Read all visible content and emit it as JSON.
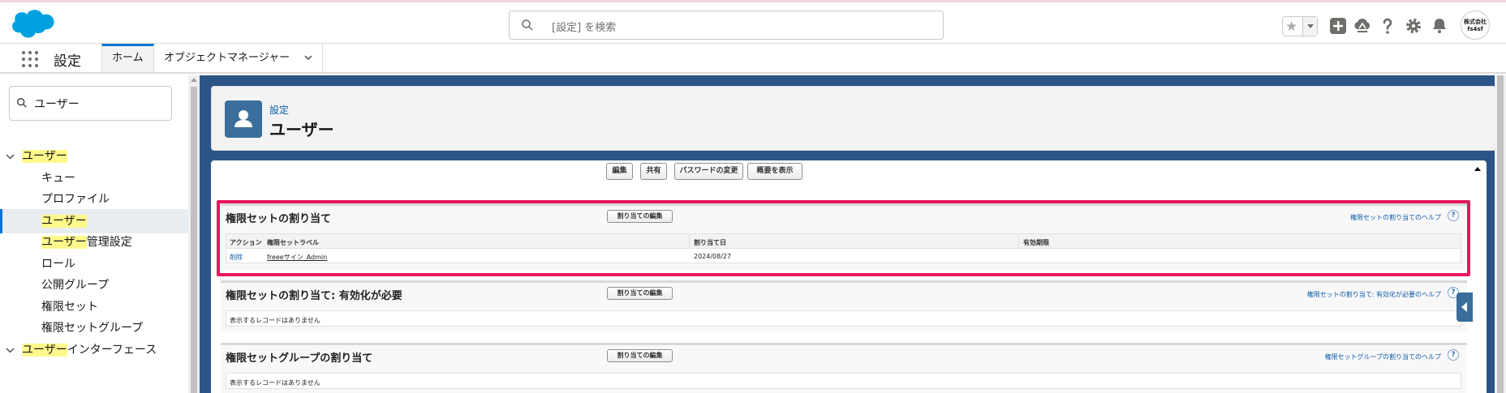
{
  "header": {
    "search_placeholder": "[設定] を検索",
    "avatar_line1": "株式会社",
    "avatar_line2": "fs4sf"
  },
  "nav": {
    "app_name": "設定",
    "tabs": [
      {
        "label": "ホーム"
      },
      {
        "label": "オブジェクトマネージャー"
      }
    ]
  },
  "sidebar": {
    "quick_find_value": "ユーザー",
    "items": [
      {
        "label": "ユーザー",
        "highlight": "ユーザー",
        "rest": ""
      },
      {
        "label": "キュー"
      },
      {
        "label": "プロファイル"
      },
      {
        "label": "ユーザー",
        "highlight": "ユーザー",
        "rest": ""
      },
      {
        "label": "ユーザー管理設定",
        "highlight": "ユーザー",
        "rest": "管理設定"
      },
      {
        "label": "ロール"
      },
      {
        "label": "公開グループ"
      },
      {
        "label": "権限セット"
      },
      {
        "label": "権限セットグループ"
      },
      {
        "label": "ユーザーインターフェース",
        "highlight": "ユーザー",
        "rest": "インターフェース"
      }
    ]
  },
  "page_header": {
    "breadcrumb": "設定",
    "title": "ユーザー"
  },
  "buttons": [
    "編集",
    "共有",
    "パスワードの変更",
    "概要を表示"
  ],
  "sections": [
    {
      "title": "権限セットの割り当て",
      "edit_button": "割り当ての編集",
      "help_link": "権限セットの割り当てのヘルプ",
      "columns": [
        "アクション",
        "権限セットラベル",
        "割り当て日",
        "有効期限"
      ],
      "rows": [
        {
          "action": "削除",
          "label": "freeeサイン_Admin",
          "assigned": "2024/08/27",
          "expires": ""
        }
      ]
    },
    {
      "title": "権限セットの割り当て: 有効化が必要",
      "edit_button": "割り当ての編集",
      "help_link": "権限セットの割り当て: 有効化が必要のヘルプ",
      "empty_text": "表示するレコードはありません"
    },
    {
      "title": "権限セットグループの割り当て",
      "edit_button": "割り当ての編集",
      "help_link": "権限セットグループの割り当てのヘルプ",
      "empty_text": "表示するレコードはありません"
    }
  ],
  "help_symbol": "?",
  "colors": {
    "brand": "#00a1e0",
    "highlight_frame": "#e8175d",
    "background": "#2c5487"
  }
}
